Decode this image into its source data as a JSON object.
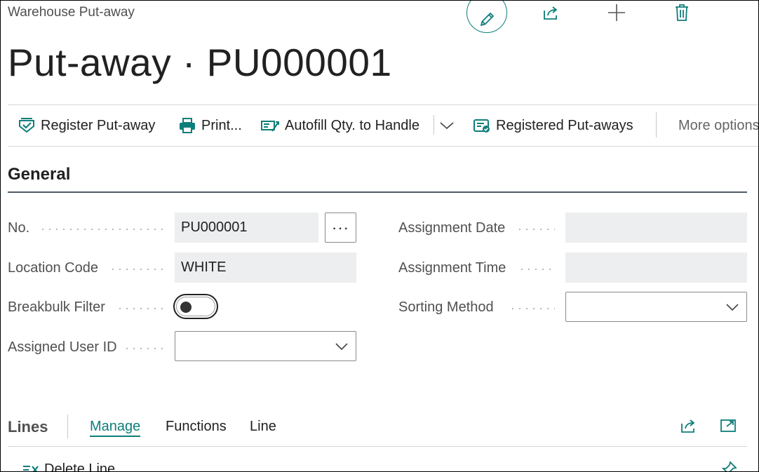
{
  "breadcrumb": "Warehouse Put-away",
  "page_title": "Put-away · PU000001",
  "top_actions": {
    "edit": "pencil-icon",
    "share": "share-icon",
    "new": "plus-icon",
    "delete": "trash-icon"
  },
  "action_bar": {
    "register": "Register Put-away",
    "print": "Print...",
    "autofill": "Autofill Qty. to Handle",
    "registered": "Registered Put-aways",
    "more": "More options"
  },
  "general": {
    "title": "General",
    "no_label": "No.",
    "no_value": "PU000001",
    "assist_label": "···",
    "location_label": "Location Code",
    "location_value": "WHITE",
    "breakbulk_label": "Breakbulk Filter",
    "breakbulk_on": false,
    "assigned_user_label": "Assigned User ID",
    "assigned_user_value": "",
    "assignment_date_label": "Assignment Date",
    "assignment_date_value": "",
    "assignment_time_label": "Assignment Time",
    "assignment_time_value": "",
    "sorting_method_label": "Sorting Method",
    "sorting_method_value": ""
  },
  "lines": {
    "title": "Lines",
    "tabs": [
      "Manage",
      "Functions",
      "Line"
    ],
    "active_tab": "Manage",
    "delete_line": "Delete Line"
  },
  "colors": {
    "accent": "#0e7e7a",
    "field_bg": "#edeeef",
    "label": "#505050"
  }
}
